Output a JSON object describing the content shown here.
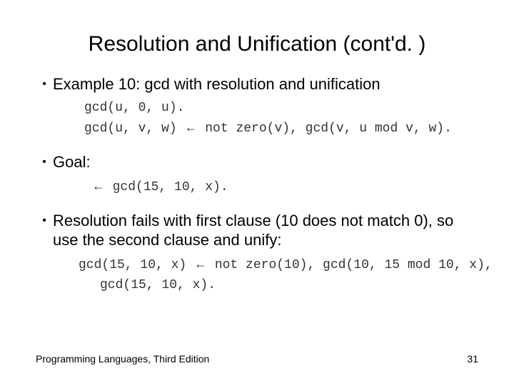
{
  "title": "Resolution and Unification (cont'd. )",
  "bullets": {
    "b1": "Example 10: gcd with resolution and unification",
    "b2": "Goal:",
    "b3": "Resolution fails with first clause (10 does not match 0), so use the second clause and unify:"
  },
  "code": {
    "fact1": "gcd(u, 0, u).",
    "fact2_left": "gcd(u, v, w) ",
    "fact2_right": " not zero(v), gcd(v, u mod v, w).",
    "goal_pre": " ",
    "goal": " gcd(15, 10, x).",
    "unify1_left": "gcd(15, 10, x) ",
    "unify1_right": " not zero(10), gcd(10, 15 mod 10, x),",
    "unify2": "gcd(15, 10, x)."
  },
  "arrow": "←",
  "footer": {
    "left": "Programming Languages, Third Edition",
    "right": "31"
  }
}
